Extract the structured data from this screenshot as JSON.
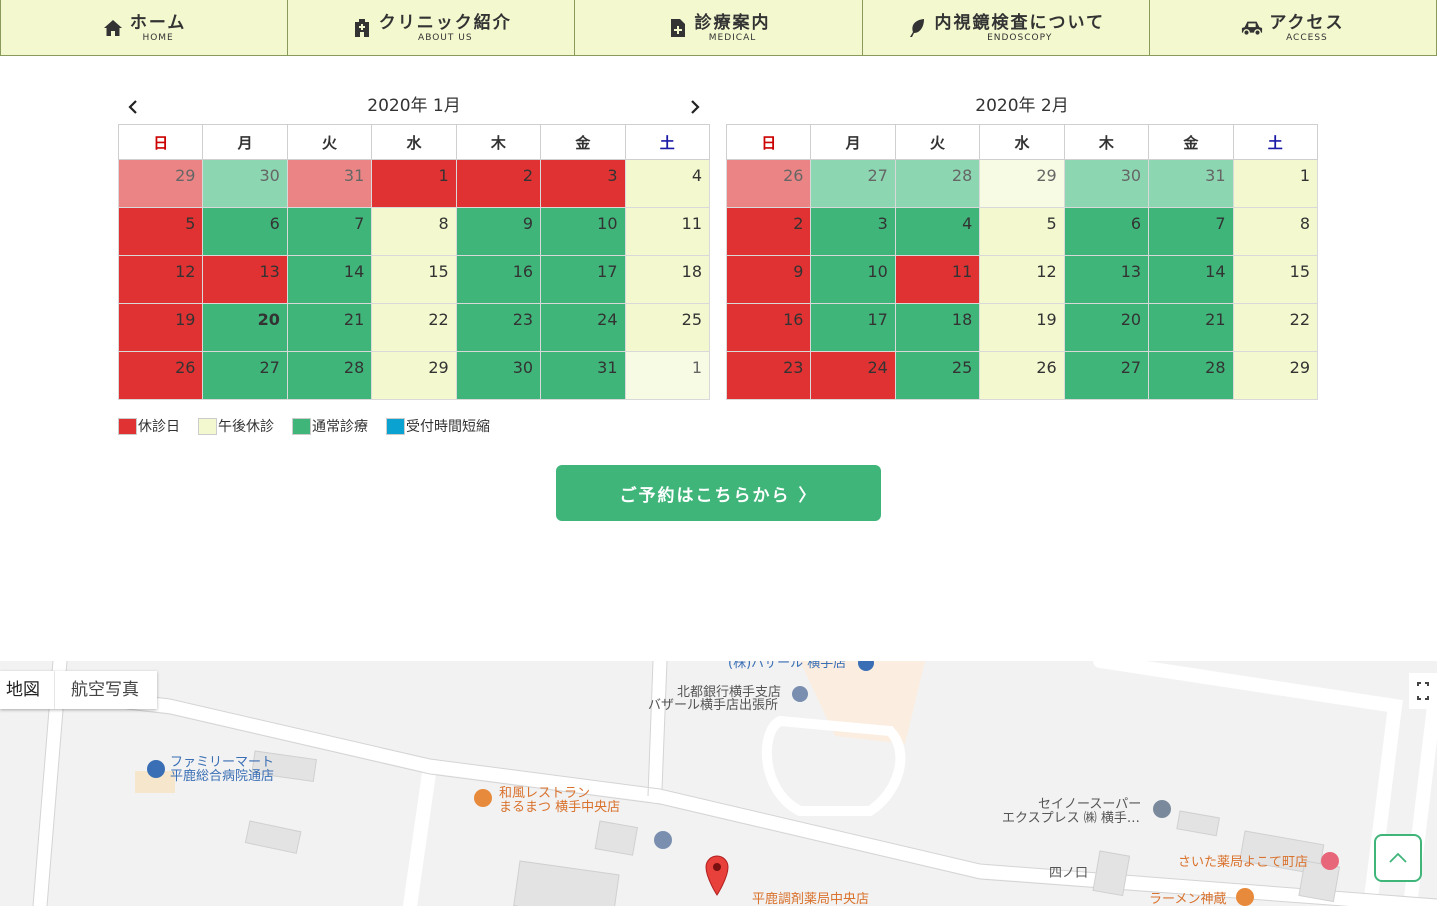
{
  "nav": [
    {
      "jp": "ホーム",
      "en": "HOME",
      "icon": "home-icon"
    },
    {
      "jp": "クリニック紹介",
      "en": "ABOUT US",
      "icon": "clinic-building-icon"
    },
    {
      "jp": "診療案内",
      "en": "MEDICAL",
      "icon": "medical-document-icon"
    },
    {
      "jp": "内視鏡検査について",
      "en": "ENDOSCOPY",
      "icon": "leaf-icon"
    },
    {
      "jp": "アクセス",
      "en": "ACCESS",
      "icon": "car-icon"
    }
  ],
  "weekdays": [
    "日",
    "月",
    "火",
    "水",
    "木",
    "金",
    "土"
  ],
  "calendars": [
    {
      "title": "2020年 1月",
      "today": "20",
      "weeks": [
        [
          [
            "29",
            "red",
            true
          ],
          [
            "30",
            "green",
            true
          ],
          [
            "31",
            "red",
            true
          ],
          [
            "1",
            "red",
            false
          ],
          [
            "2",
            "red",
            false
          ],
          [
            "3",
            "red",
            false
          ],
          [
            "4",
            "cream",
            false
          ]
        ],
        [
          [
            "5",
            "red",
            false
          ],
          [
            "6",
            "green",
            false
          ],
          [
            "7",
            "green",
            false
          ],
          [
            "8",
            "cream",
            false
          ],
          [
            "9",
            "green",
            false
          ],
          [
            "10",
            "green",
            false
          ],
          [
            "11",
            "cream",
            false
          ]
        ],
        [
          [
            "12",
            "red",
            false
          ],
          [
            "13",
            "red",
            false
          ],
          [
            "14",
            "green",
            false
          ],
          [
            "15",
            "cream",
            false
          ],
          [
            "16",
            "green",
            false
          ],
          [
            "17",
            "green",
            false
          ],
          [
            "18",
            "cream",
            false
          ]
        ],
        [
          [
            "19",
            "red",
            false
          ],
          [
            "20",
            "green",
            false
          ],
          [
            "21",
            "green",
            false
          ],
          [
            "22",
            "cream",
            false
          ],
          [
            "23",
            "green",
            false
          ],
          [
            "24",
            "green",
            false
          ],
          [
            "25",
            "cream",
            false
          ]
        ],
        [
          [
            "26",
            "red",
            false
          ],
          [
            "27",
            "green",
            false
          ],
          [
            "28",
            "green",
            false
          ],
          [
            "29",
            "cream",
            false
          ],
          [
            "30",
            "green",
            false
          ],
          [
            "31",
            "green",
            false
          ],
          [
            "1",
            "cream",
            true
          ]
        ]
      ]
    },
    {
      "title": "2020年 2月",
      "today": "",
      "weeks": [
        [
          [
            "26",
            "red",
            true
          ],
          [
            "27",
            "green",
            true
          ],
          [
            "28",
            "green",
            true
          ],
          [
            "29",
            "cream",
            true
          ],
          [
            "30",
            "green",
            true
          ],
          [
            "31",
            "green",
            true
          ],
          [
            "1",
            "cream",
            false
          ]
        ],
        [
          [
            "2",
            "red",
            false
          ],
          [
            "3",
            "green",
            false
          ],
          [
            "4",
            "green",
            false
          ],
          [
            "5",
            "cream",
            false
          ],
          [
            "6",
            "green",
            false
          ],
          [
            "7",
            "green",
            false
          ],
          [
            "8",
            "cream",
            false
          ]
        ],
        [
          [
            "9",
            "red",
            false
          ],
          [
            "10",
            "green",
            false
          ],
          [
            "11",
            "red",
            false
          ],
          [
            "12",
            "cream",
            false
          ],
          [
            "13",
            "green",
            false
          ],
          [
            "14",
            "green",
            false
          ],
          [
            "15",
            "cream",
            false
          ]
        ],
        [
          [
            "16",
            "red",
            false
          ],
          [
            "17",
            "green",
            false
          ],
          [
            "18",
            "green",
            false
          ],
          [
            "19",
            "cream",
            false
          ],
          [
            "20",
            "green",
            false
          ],
          [
            "21",
            "green",
            false
          ],
          [
            "22",
            "cream",
            false
          ]
        ],
        [
          [
            "23",
            "red",
            false
          ],
          [
            "24",
            "red",
            false
          ],
          [
            "25",
            "green",
            false
          ],
          [
            "26",
            "cream",
            false
          ],
          [
            "27",
            "green",
            false
          ],
          [
            "28",
            "green",
            false
          ],
          [
            "29",
            "cream",
            false
          ]
        ]
      ]
    }
  ],
  "legend": [
    {
      "label": "休診日",
      "color": "#e03232"
    },
    {
      "label": "午後休診",
      "color": "#f3f8cf"
    },
    {
      "label": "通常診療",
      "color": "#3fb57a"
    },
    {
      "label": "受付時間短縮",
      "color": "#0aa3d1"
    }
  ],
  "cta": {
    "label": "ご予約はこちらから 〉"
  },
  "map": {
    "tab_map": "地図",
    "tab_aerial": "航空写真",
    "places": [
      {
        "text": "(株)バザール 横手店",
        "cls": "lbl-blue"
      },
      {
        "text": "北都銀行横手支店",
        "cls": "lbl-gray"
      },
      {
        "text": "バザール横手店出張所",
        "cls": "lbl-gray"
      },
      {
        "text": "ファミリーマート",
        "cls": "lbl-blue"
      },
      {
        "text": "平鹿総合病院通店",
        "cls": "lbl-blue"
      },
      {
        "text": "和風レストラン",
        "cls": "lbl-orange"
      },
      {
        "text": "まるまつ 横手中央店",
        "cls": "lbl-orange"
      },
      {
        "text": "セイノースーパー",
        "cls": "lbl-gray"
      },
      {
        "text": "エクスプレス ㈱ 横手…",
        "cls": "lbl-gray"
      },
      {
        "text": "四ノ口",
        "cls": "lbl-gray"
      },
      {
        "text": "さいた薬局よこて町店",
        "cls": "lbl-orange"
      },
      {
        "text": "ラーメン神蔵",
        "cls": "lbl-orange"
      },
      {
        "text": "平鹿調剤薬局中央店",
        "cls": "lbl-orange"
      }
    ]
  },
  "colors": {
    "red": "#e03232",
    "green": "#3fb57a",
    "cream": "#f3f8cf",
    "sunday": "#cc0000",
    "saturday": "#1a1aa6"
  }
}
